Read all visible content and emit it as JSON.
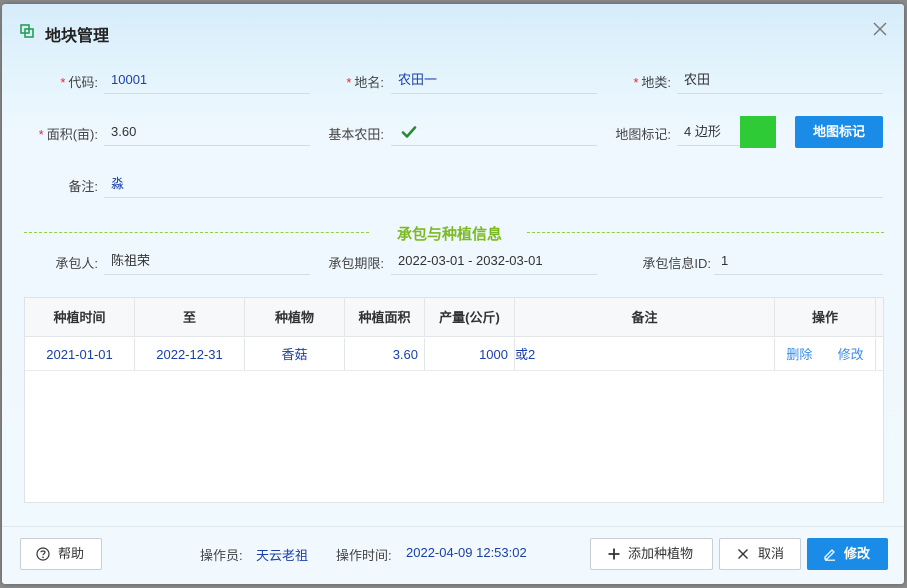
{
  "dialog": {
    "title": "地块管理"
  },
  "form": {
    "code_label": "代码:",
    "code_value": "10001",
    "name_label": "地名:",
    "name_value": "农田一",
    "type_label": "地类:",
    "type_value": "农田",
    "area_label": "面积(亩):",
    "area_value": "3.60",
    "basic_label": "基本农田:",
    "mapmark_label": "地图标记:",
    "mapmark_value": "4 边形",
    "mapmark_color": "#2fcb37",
    "mapmark_button": "地图标记",
    "note_label": "备注:",
    "note_value": "淼"
  },
  "section": {
    "title": "承包与种植信息",
    "contractor_label": "承包人:",
    "contractor_value": "陈祖荣",
    "period_label": "承包期限:",
    "period_value": "2022-03-01 - 2032-03-01",
    "contract_id_label": "承包信息ID:",
    "contract_id_value": "1"
  },
  "table": {
    "headers": [
      "种植时间",
      "至",
      "种植物",
      "种植面积",
      "产量(公斤)",
      "备注",
      "操作"
    ],
    "rows": [
      {
        "start": "2021-01-01",
        "end": "2022-12-31",
        "crop": "香菇",
        "area": "3.60",
        "yield": "1000",
        "note": "或2",
        "delete": "删除",
        "edit": "修改"
      }
    ]
  },
  "footer": {
    "help": "帮助",
    "operator_label": "操作员:",
    "operator_value": "天云老祖",
    "time_label": "操作时间:",
    "time_value": "2022-04-09 12:53:02",
    "add_crop": "添加种植物",
    "cancel": "取消",
    "modify": "修改"
  }
}
